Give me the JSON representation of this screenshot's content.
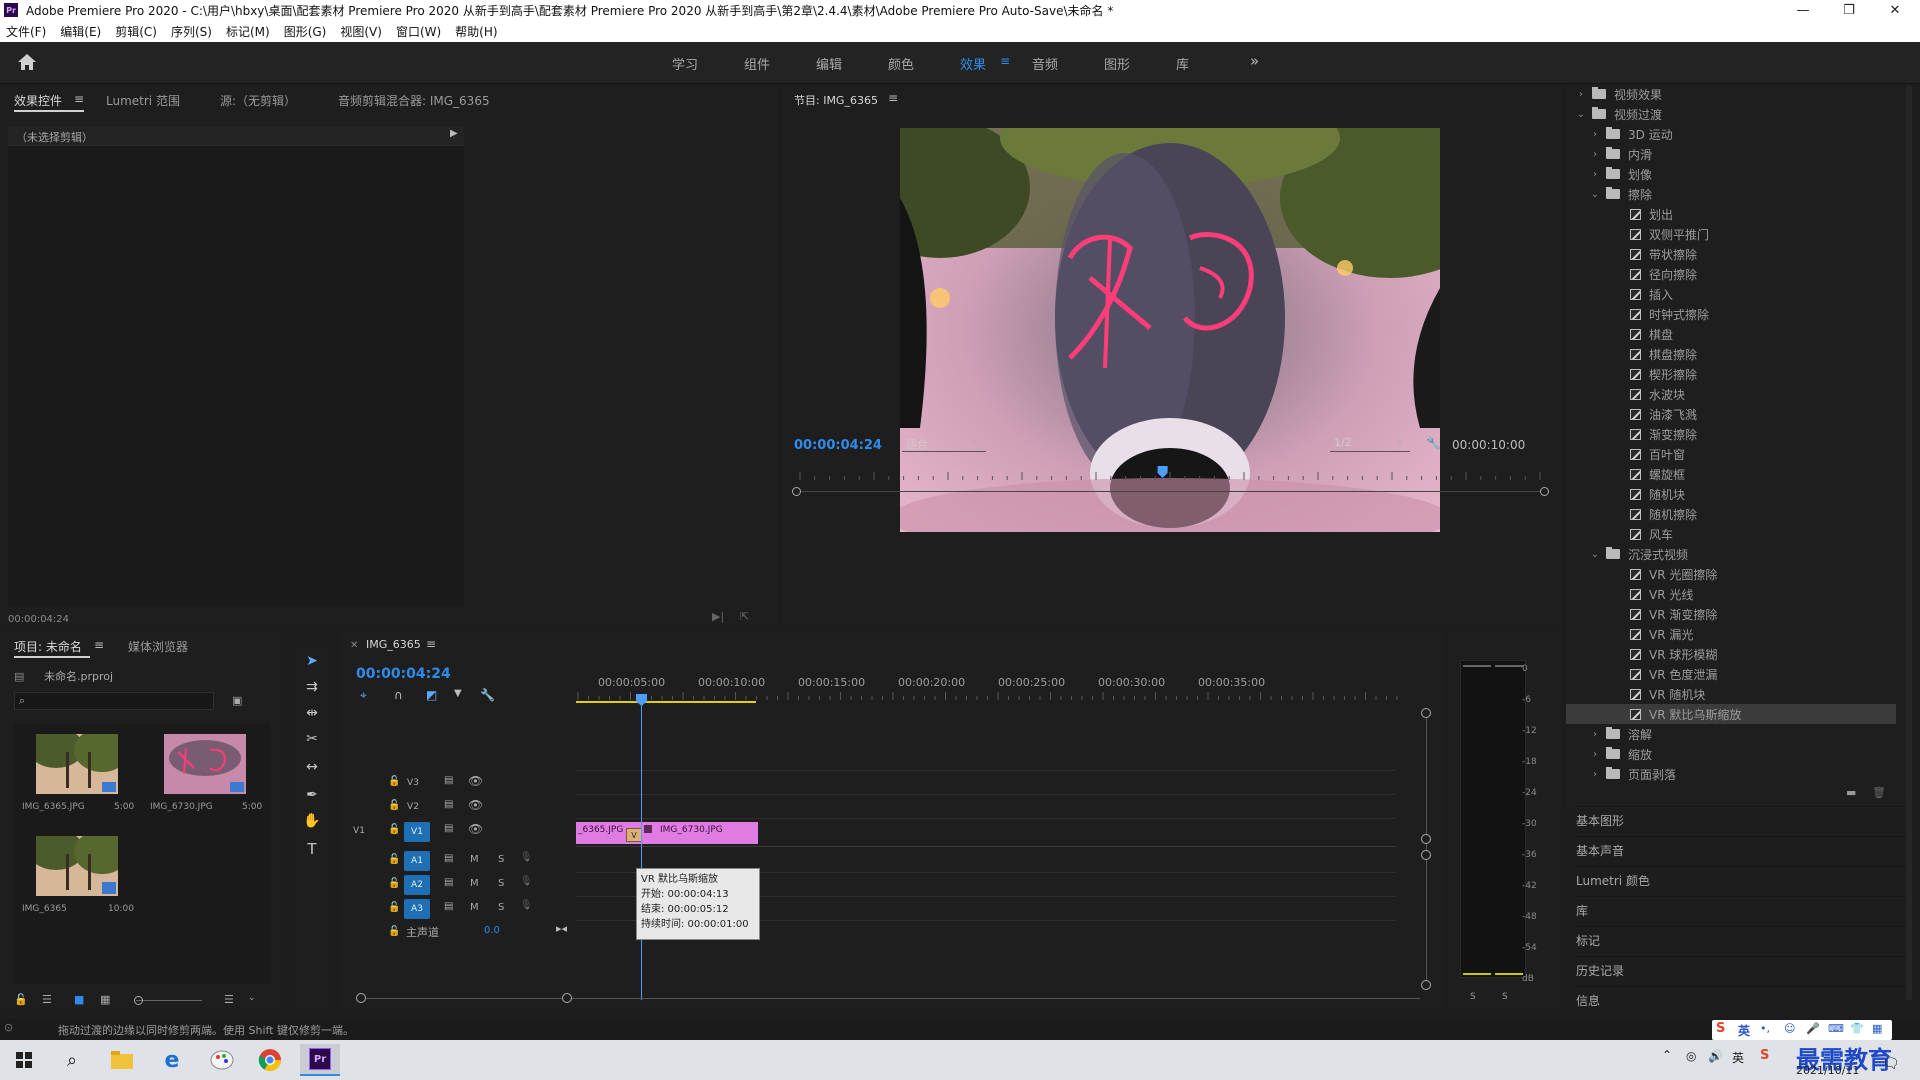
{
  "window": {
    "title": "Adobe Premiere Pro 2020 - C:\\用户\\hbxy\\桌面\\配套素材 Premiere Pro 2020 从新手到高手\\配套素材 Premiere Pro 2020 从新手到高手\\第2章\\2.4.4\\素材\\Adobe Premiere Pro Auto-Save\\未命名 *",
    "logo": "Pr"
  },
  "menu": [
    "文件(F)",
    "编辑(E)",
    "剪辑(C)",
    "序列(S)",
    "标记(M)",
    "图形(G)",
    "视图(V)",
    "窗口(W)",
    "帮助(H)"
  ],
  "workspaces": [
    "学习",
    "组件",
    "编辑",
    "颜色",
    "效果",
    "音频",
    "图形",
    "库"
  ],
  "workspace_active": "效果",
  "source_panel": {
    "tabs": [
      "效果控件",
      "Lumetri 范围",
      "源:（无剪辑）",
      "音频剪辑混合器: IMG_6365"
    ],
    "no_clip": "（未选择剪辑）",
    "timecode": "00:00:04:24"
  },
  "program_monitor": {
    "title": "节目: IMG_6365",
    "timecode": "00:00:04:24",
    "fit": "适合",
    "resolution": "1/2",
    "duration": "00:00:10:00",
    "playhead_fraction": 0.49
  },
  "project_panel": {
    "tabs": [
      "项目: 未命名",
      "媒体浏览器"
    ],
    "file": "未命名.prproj",
    "items": [
      {
        "name": "IMG_6365.JPG",
        "duration": "5:00"
      },
      {
        "name": "IMG_6730.JPG",
        "duration": "5:00"
      },
      {
        "name": "IMG_6365",
        "duration": "10:00"
      }
    ]
  },
  "timeline": {
    "sequence": "IMG_6365",
    "timecode": "00:00:04:24",
    "ruler": [
      "00:00:05:00",
      "00:00:10:00",
      "00:00:15:00",
      "00:00:20:00",
      "00:00:25:00",
      "00:00:30:00",
      "00:00:35:00"
    ],
    "video_tracks": [
      "V3",
      "V2",
      "V1"
    ],
    "source_patch": "V1",
    "audio_tracks": [
      "A1",
      "A2",
      "A3"
    ],
    "master": "主声道",
    "master_value": "0.0",
    "clips": [
      "_6365.JPG",
      "IMG_6730.JPG"
    ],
    "transition_badge": "V",
    "tooltip": {
      "name": "VR 默比乌斯缩放",
      "start": "开始: 00:00:04:13",
      "end": "结束: 00:00:05:12",
      "duration": "持续时间: 00:00:01:00"
    },
    "mute": "M",
    "solo": "S"
  },
  "meter": {
    "labels": [
      "0",
      "-6",
      "-12",
      "-18",
      "-24",
      "-30",
      "-36",
      "-42",
      "-48",
      "-54",
      "dB"
    ],
    "solo": [
      "S",
      "S"
    ]
  },
  "effects_tree": [
    {
      "level": 0,
      "type": "folder",
      "label": "视频效果",
      "open": false
    },
    {
      "level": 0,
      "type": "folder",
      "label": "视频过渡",
      "open": true
    },
    {
      "level": 1,
      "type": "folder",
      "label": "3D 运动",
      "open": false
    },
    {
      "level": 1,
      "type": "folder",
      "label": "内滑",
      "open": false
    },
    {
      "level": 1,
      "type": "folder",
      "label": "划像",
      "open": false
    },
    {
      "level": 1,
      "type": "folder",
      "label": "擦除",
      "open": true
    },
    {
      "level": 2,
      "type": "fx",
      "label": "划出"
    },
    {
      "level": 2,
      "type": "fx",
      "label": "双侧平推门"
    },
    {
      "level": 2,
      "type": "fx",
      "label": "带状擦除"
    },
    {
      "level": 2,
      "type": "fx",
      "label": "径向擦除"
    },
    {
      "level": 2,
      "type": "fx",
      "label": "插入"
    },
    {
      "level": 2,
      "type": "fx",
      "label": "时钟式擦除"
    },
    {
      "level": 2,
      "type": "fx",
      "label": "棋盘"
    },
    {
      "level": 2,
      "type": "fx",
      "label": "棋盘擦除"
    },
    {
      "level": 2,
      "type": "fx",
      "label": "楔形擦除"
    },
    {
      "level": 2,
      "type": "fx",
      "label": "水波块"
    },
    {
      "level": 2,
      "type": "fx",
      "label": "油漆飞溅"
    },
    {
      "level": 2,
      "type": "fx",
      "label": "渐变擦除"
    },
    {
      "level": 2,
      "type": "fx",
      "label": "百叶窗"
    },
    {
      "level": 2,
      "type": "fx",
      "label": "螺旋框"
    },
    {
      "level": 2,
      "type": "fx",
      "label": "随机块"
    },
    {
      "level": 2,
      "type": "fx",
      "label": "随机擦除"
    },
    {
      "level": 2,
      "type": "fx",
      "label": "风车"
    },
    {
      "level": 1,
      "type": "folder",
      "label": "沉浸式视频",
      "open": true
    },
    {
      "level": 2,
      "type": "fx",
      "label": "VR 光圈擦除"
    },
    {
      "level": 2,
      "type": "fx",
      "label": "VR 光线"
    },
    {
      "level": 2,
      "type": "fx",
      "label": "VR 渐变擦除"
    },
    {
      "level": 2,
      "type": "fx",
      "label": "VR 漏光"
    },
    {
      "level": 2,
      "type": "fx",
      "label": "VR 球形模糊"
    },
    {
      "level": 2,
      "type": "fx",
      "label": "VR 色度泄漏"
    },
    {
      "level": 2,
      "type": "fx",
      "label": "VR 随机块"
    },
    {
      "level": 2,
      "type": "fx",
      "label": "VR 默比乌斯缩放",
      "selected": true
    },
    {
      "level": 1,
      "type": "folder",
      "label": "溶解",
      "open": false
    },
    {
      "level": 1,
      "type": "folder",
      "label": "缩放",
      "open": false
    },
    {
      "level": 1,
      "type": "folder",
      "label": "页面剥落",
      "open": false
    }
  ],
  "side_panels": [
    "基本图形",
    "基本声音",
    "Lumetri 颜色",
    "库",
    "标记",
    "历史记录",
    "信息"
  ],
  "status_bar": "拖动过渡的边缘以同时修剪两端。使用 Shift 键仅修剪一端。",
  "tray": {
    "ime": "英",
    "date": "2021/10/11",
    "watermark": "最需教育"
  },
  "colors": {
    "accent": "#2d8ceb",
    "clip": "#e07be3",
    "track_target": "#1f6fb5",
    "panel": "#1e1e1e"
  }
}
